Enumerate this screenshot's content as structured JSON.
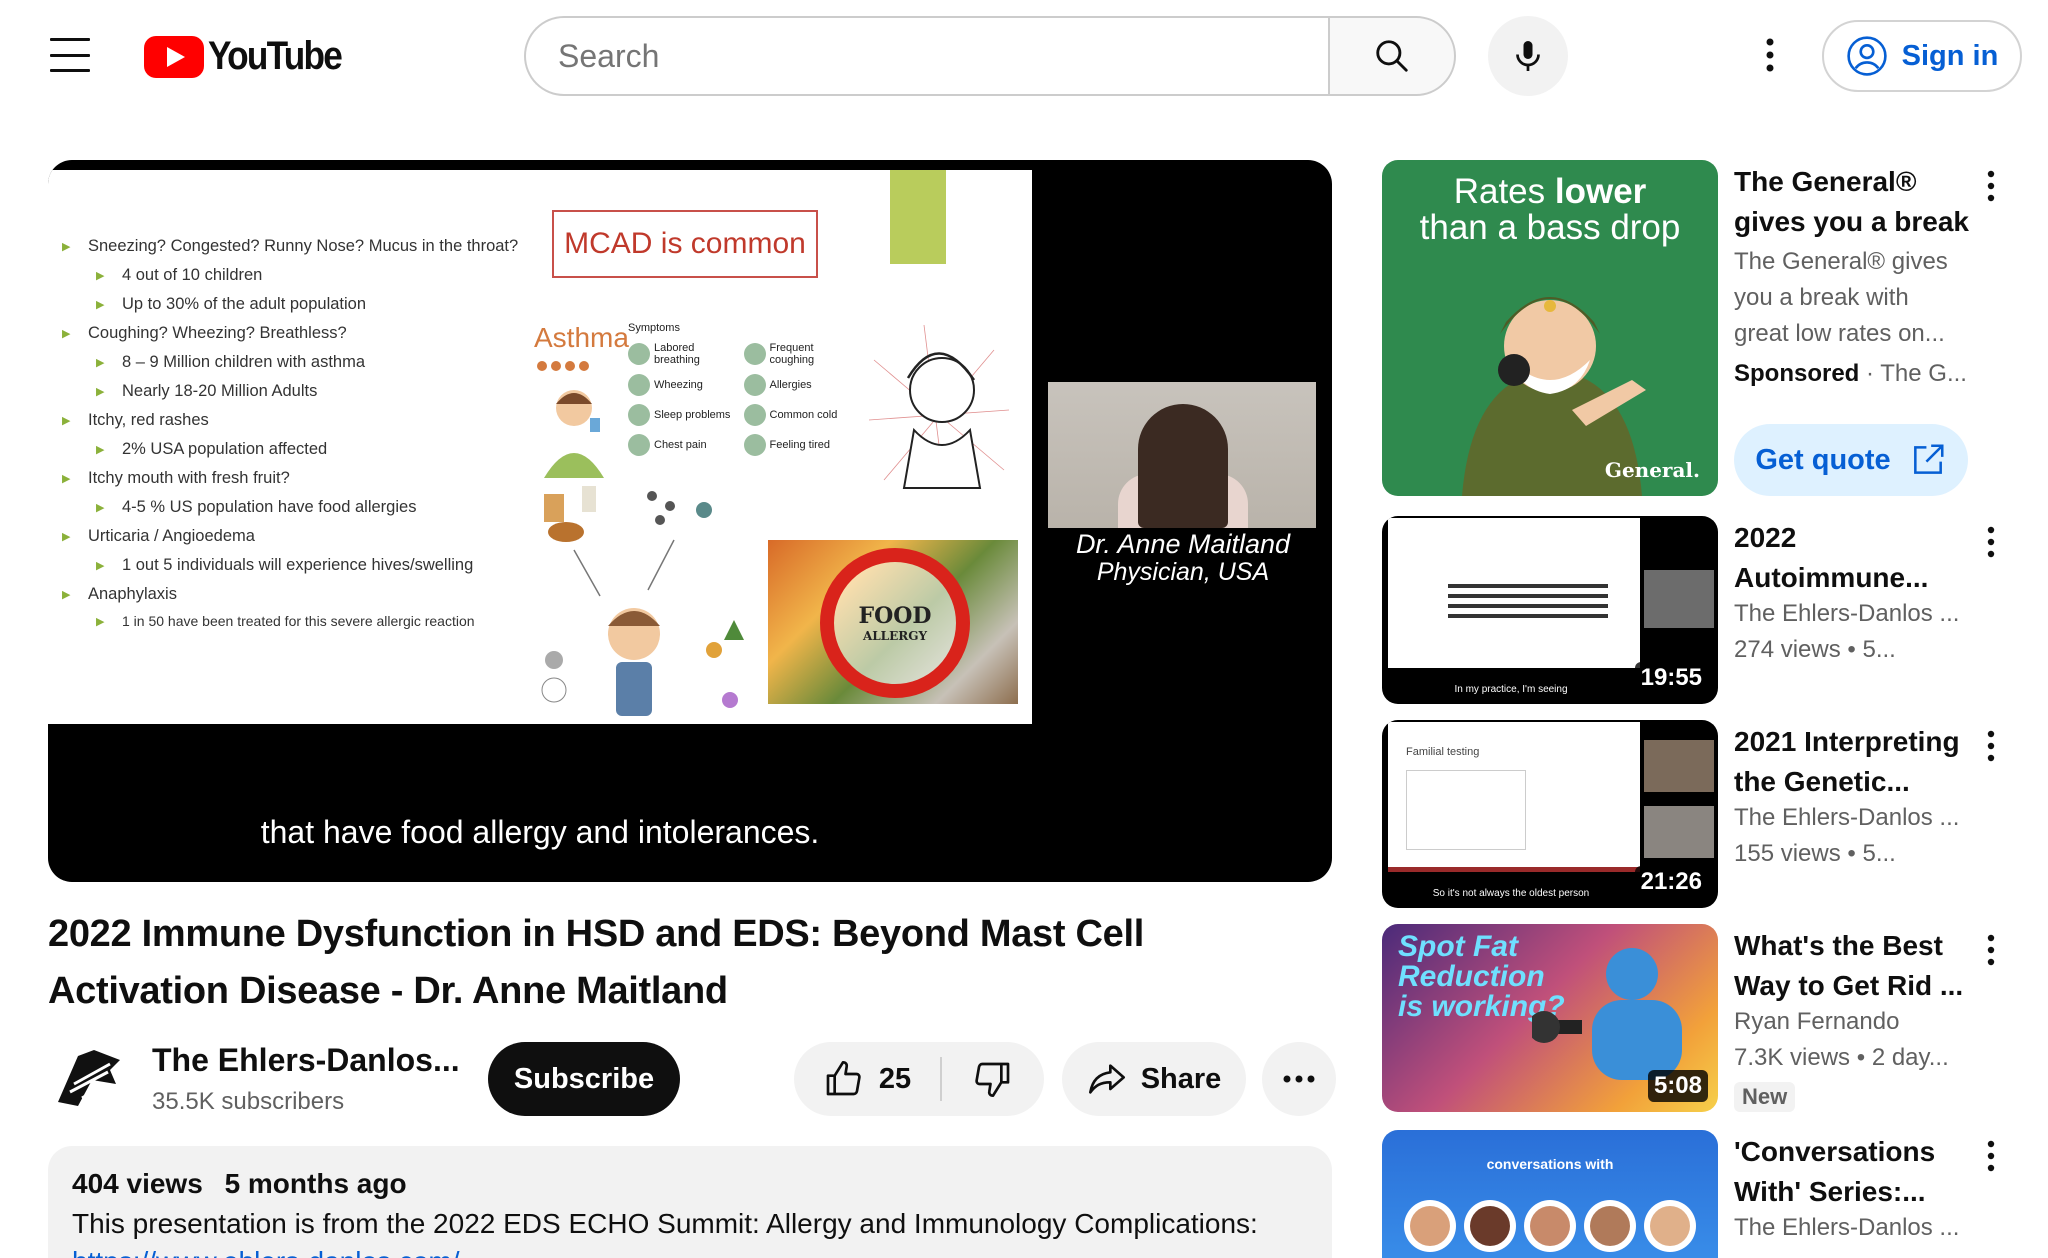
{
  "header": {
    "logo_text": "YouTube",
    "country_code": "",
    "search_placeholder": "Search",
    "signin_label": "Sign in"
  },
  "player": {
    "slide": {
      "heading": "MCAD is common",
      "bullets": [
        {
          "level": 1,
          "text": "Sneezing? Congested? Runny Nose? Mucus in the throat?"
        },
        {
          "level": 2,
          "text": "4 out of 10 children"
        },
        {
          "level": 2,
          "text": "Up to 30% of the adult population"
        },
        {
          "level": 1,
          "text": "Coughing? Wheezing? Breathless?"
        },
        {
          "level": 2,
          "text": "8 – 9 Million children with asthma"
        },
        {
          "level": 2,
          "text": "Nearly 18-20 Million Adults"
        },
        {
          "level": 1,
          "text": "Itchy, red rashes"
        },
        {
          "level": 2,
          "text": "2% USA population affected"
        },
        {
          "level": 1,
          "text": "Itchy mouth with fresh fruit?"
        },
        {
          "level": 2,
          "text": "4-5 % US population have food allergies"
        },
        {
          "level": 1,
          "text": "Urticaria  / Angioedema"
        },
        {
          "level": 2,
          "text": "1 out 5 individuals will experience hives/swelling"
        },
        {
          "level": 1,
          "text": "Anaphylaxis"
        },
        {
          "level": 2,
          "text": "1 in 50 have been treated for this severe allergic reaction"
        }
      ],
      "asthma_label": "Asthma",
      "symptoms_title": "Symptoms",
      "symptoms": [
        "Labored breathing",
        "Frequent coughing",
        "Wheezing",
        "Allergies",
        "Sleep problems",
        "Common cold",
        "Chest pain",
        "Feeling tired"
      ],
      "food_allergy_line1": "FOOD",
      "food_allergy_line2": "ALLERGY"
    },
    "speaker_name": "Dr. Anne Maitland",
    "speaker_title": "Physician, USA",
    "caption": "that have food allergy and intolerances."
  },
  "video": {
    "title": "2022 Immune Dysfunction in HSD and EDS: Beyond Mast Cell Activation Disease - Dr. Anne Maitland",
    "channel_name": "The Ehlers-Danlos...",
    "subscribers": "35.5K subscribers",
    "subscribe_label": "Subscribe",
    "likes": "25",
    "share_label": "Share"
  },
  "description": {
    "views": "404 views",
    "age": "5 months ago",
    "text": "This presentation is from the 2022 EDS ECHO Summit: Allergy and Immunology Complications:",
    "link": "https://www.ehlers-danlos.com/"
  },
  "sidebar": {
    "ad": {
      "thumb_line1a": "Rates",
      "thumb_line1b": "lower",
      "thumb_line2": "than a bass drop",
      "brand_mark": "General.",
      "title": "The General® gives you a break",
      "body": "The General® gives you a break with great low rates on...",
      "sponsored": "Sponsored",
      "advertiser": "The G...",
      "cta": "Get quote"
    },
    "videos": [
      {
        "title": "2022 Autoimmune...",
        "channel": "The Ehlers-Danlos ...",
        "views": "274 views",
        "age": "5...",
        "duration": "19:55",
        "thumb_caption": "In my practice, I'm seeing"
      },
      {
        "title": "2021 Interpreting the Genetic...",
        "channel": "The Ehlers-Danlos ...",
        "views": "155 views",
        "age": "5...",
        "duration": "21:26",
        "thumb_heading": "Familial testing",
        "thumb_caption": "So it's not always the oldest person"
      },
      {
        "title": "What's the Best Way to Get Rid ...",
        "channel": "Ryan Fernando",
        "views": "7.3K views",
        "age": "2 day...",
        "duration": "5:08",
        "badge": "New",
        "thumb_text": "Spot Fat Reduction is working?"
      },
      {
        "title": "'Conversations With' Series:...",
        "channel": "The Ehlers-Danlos ...",
        "thumb_text": "conversations with"
      }
    ]
  }
}
